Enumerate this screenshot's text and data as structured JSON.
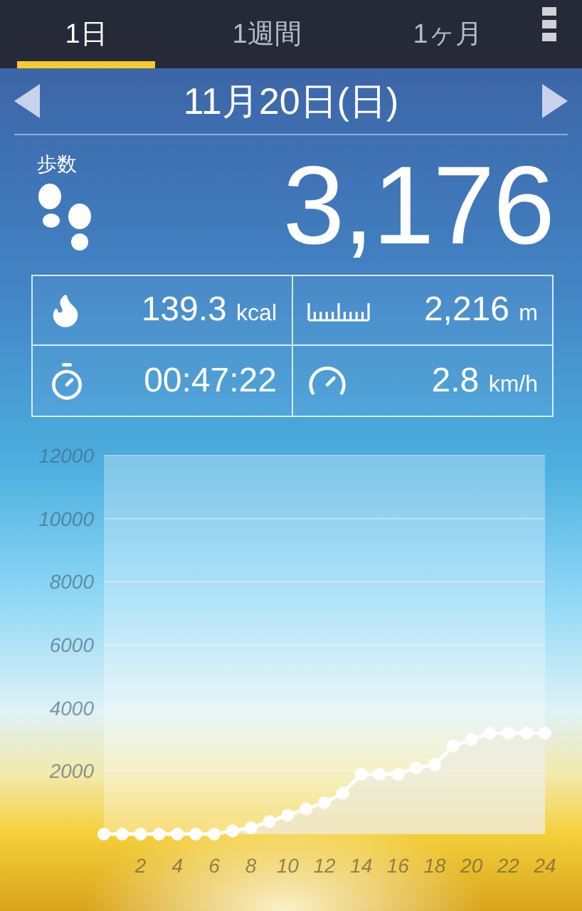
{
  "tabs": [
    {
      "label": "1日",
      "selected": true
    },
    {
      "label": "1週間",
      "selected": false
    },
    {
      "label": "1ヶ月",
      "selected": false
    }
  ],
  "date_nav": {
    "date": "11月20日(日)"
  },
  "steps": {
    "label": "歩数",
    "value": "3,176"
  },
  "stats": [
    {
      "kind": "calories",
      "value": "139.3",
      "unit": "kcal"
    },
    {
      "kind": "distance",
      "value": "2,216",
      "unit": "m"
    },
    {
      "kind": "time",
      "value": "00:47:22"
    },
    {
      "kind": "speed",
      "value": "2.8",
      "unit": "km/h"
    }
  ],
  "chart": {
    "chart_data": {
      "type": "line",
      "x": [
        0,
        1,
        2,
        3,
        4,
        5,
        6,
        7,
        8,
        9,
        10,
        11,
        12,
        13,
        14,
        15,
        16,
        17,
        18,
        19,
        20,
        21,
        22,
        23,
        24
      ],
      "xlim": [
        0,
        24
      ],
      "ylim": [
        0,
        12000
      ],
      "xticks": [
        2,
        4,
        6,
        8,
        10,
        12,
        14,
        16,
        18,
        20,
        22,
        24
      ],
      "yticks": [
        2000,
        4000,
        6000,
        8000,
        10000,
        12000
      ],
      "grid": true,
      "series": [
        {
          "marker": true,
          "values": [
            0,
            0,
            0,
            0,
            0,
            0,
            0,
            100,
            200,
            400,
            600,
            800,
            1000,
            1300,
            1900,
            1900,
            1900,
            2100,
            2200,
            2800,
            3000,
            3200,
            3200,
            3200,
            3200
          ]
        }
      ]
    }
  }
}
